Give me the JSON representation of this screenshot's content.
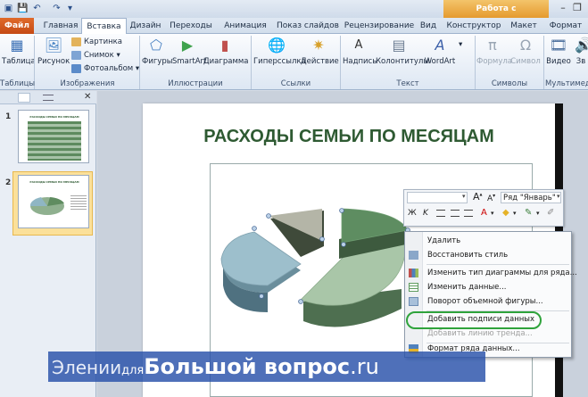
{
  "context_tab_group": "Работа с диаграммами",
  "tabs": {
    "file": "Файл",
    "home": "Главная",
    "insert": "Вставка",
    "design": "Дизайн",
    "transitions": "Переходы",
    "animation": "Анимация",
    "slideshow": "Показ слайдов",
    "review": "Рецензирование",
    "view": "Вид",
    "constructor": "Конструктор",
    "layout": "Макет",
    "format": "Формат"
  },
  "ribbon": {
    "table": "Таблица",
    "picture": "Рисунок",
    "clipart": "Картинка",
    "screenshot": "Снимок",
    "photoalbum": "Фотоальбом",
    "shapes": "Фигуры",
    "smartart": "SmartArt",
    "chart": "Диаграмма",
    "hyperlink": "Гиперссылка",
    "action": "Действие",
    "textbox": "Надпись",
    "header_footer": "Колонтитулы",
    "wordart": "WordArt",
    "equation": "Формула",
    "symbol": "Символ",
    "video": "Видео",
    "sound": "Зв",
    "groups": {
      "tables": "Таблицы",
      "images": "Изображения",
      "illustrations": "Иллюстрации",
      "links": "Ссылки",
      "text": "Текст",
      "symbols": "Символы",
      "multimedia": "Мультимед"
    }
  },
  "slides": [
    {
      "num": "1",
      "title": "РАСХОДЫ СЕМЬИ ПО МЕСЯЦАМ"
    },
    {
      "num": "2",
      "title": "РАСХОДЫ СЕМЬИ ПО МЕСЯЦАМ"
    }
  ],
  "slide_title": "РАСХОДЫ СЕМЬИ ПО МЕСЯЦАМ",
  "mini_toolbar": {
    "series_select": "Ряд \"Январь\"",
    "grow_font": "A",
    "shrink_font": "A",
    "italic": "K",
    "font_color": "A"
  },
  "context_menu": [
    {
      "label": "Удалить",
      "disabled": false
    },
    {
      "label": "Восстановить стиль",
      "disabled": false
    },
    {
      "label": "Изменить тип диаграммы для ряда...",
      "disabled": false
    },
    {
      "label": "Изменить данные...",
      "disabled": false
    },
    {
      "label": "Поворот объемной фигуры...",
      "disabled": false
    },
    {
      "label": "Добавить подписи данных",
      "disabled": false
    },
    {
      "label": "Добавить линию тренда...",
      "disabled": true
    },
    {
      "label": "Формат ряда данных...",
      "disabled": false
    }
  ],
  "watermark": {
    "part1": "Элении",
    "part2": "для",
    "part3": "Большой вопрос",
    "part4": ".ru"
  },
  "colors": {
    "accent_green": "#2e5a32",
    "file_tab": "#c54a15",
    "context_tab": "#e59a2e",
    "highlight": "#2fa33c"
  }
}
